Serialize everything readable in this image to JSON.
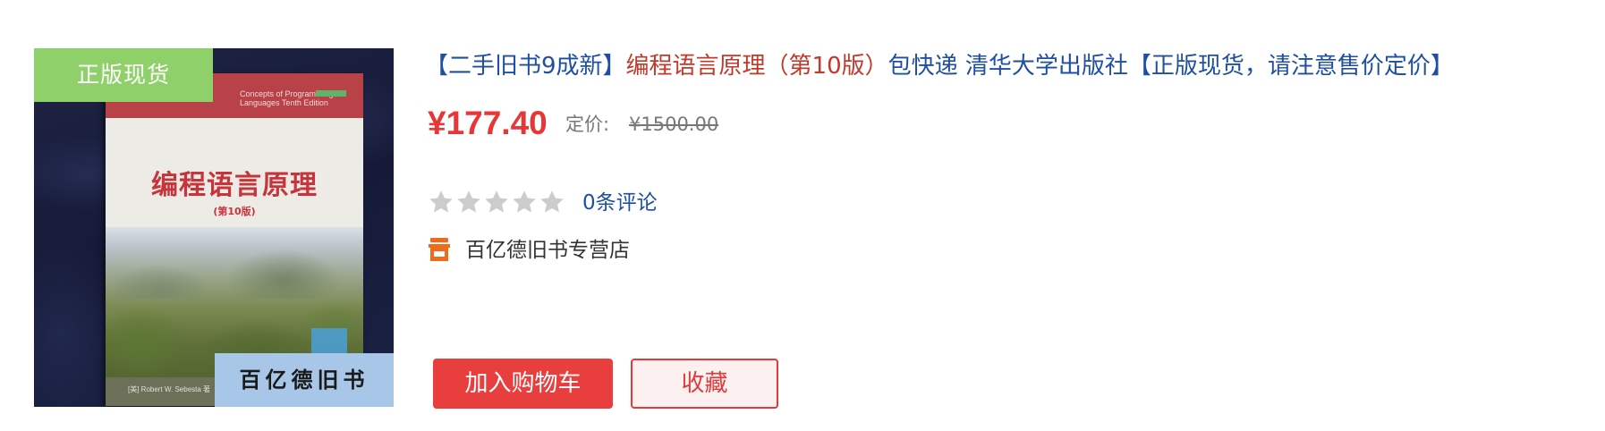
{
  "product": {
    "cover": {
      "badge_top": "正版现货",
      "badge_bottom": "百亿德旧书",
      "book_title": "编程语言原理",
      "book_subtitle": "(第10版)",
      "book_edition_en": "Concepts of Programming Languages  Tenth Edition",
      "book_author": "[美] Robert W. Sebesta  著"
    },
    "title": {
      "prefix": "【二手旧书9成新】",
      "highlight": "编程语言原理（第10版）",
      "suffix": "包快递 清华大学出版社【正版现货，请注意售价定价】"
    },
    "price": {
      "current": "¥177.40",
      "list_label": "定价:",
      "list_value": "¥1500.00"
    },
    "rating": {
      "stars_filled": 0,
      "stars_total": 5,
      "star_color_empty": "#cccccc",
      "review_link": "0条评论"
    },
    "shop": {
      "icon": "shop-icon",
      "icon_color": "#f06a1a",
      "name": "百亿德旧书专营店"
    },
    "actions": {
      "add_to_cart": "加入购物车",
      "favorite": "收藏"
    },
    "colors": {
      "price": "#e83535",
      "link": "#1f4fa0",
      "title_highlight": "#c0392b",
      "cart_button": "#e83e3e",
      "badge_top": "#8fd06a",
      "badge_bottom": "#a8c6e8"
    }
  }
}
